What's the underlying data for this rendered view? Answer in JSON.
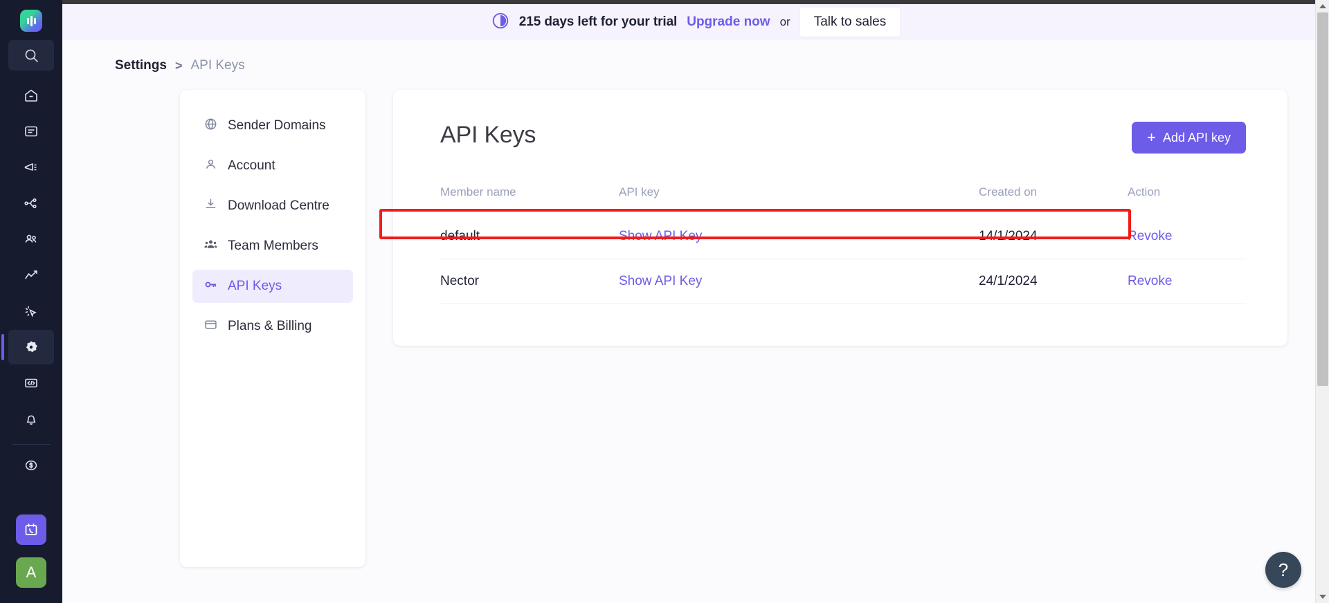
{
  "colors": {
    "brand_purple": "#6c5ce7",
    "rail_dark": "#161b2e",
    "banner_bg": "#f6f3ff",
    "highlight_red": "#f01c1c",
    "avatar_green": "#6aa84f",
    "help_navy": "#37475a"
  },
  "rail": {
    "logo_name": "app-logo",
    "search_icon": "search-icon",
    "items": [
      {
        "icon": "home-icon",
        "name": "rail-item-home",
        "active": false
      },
      {
        "icon": "inbox-icon",
        "name": "rail-item-inbox",
        "active": false
      },
      {
        "icon": "megaphone-icon",
        "name": "rail-item-campaigns",
        "active": false
      },
      {
        "icon": "workflow-icon",
        "name": "rail-item-workflows",
        "active": false
      },
      {
        "icon": "people-icon",
        "name": "rail-item-audience",
        "active": false
      },
      {
        "icon": "chart-line-icon",
        "name": "rail-item-analytics",
        "active": false
      },
      {
        "icon": "cursor-click-icon",
        "name": "rail-item-events",
        "active": false
      },
      {
        "icon": "gear-icon",
        "name": "rail-item-settings",
        "active": true
      },
      {
        "icon": "code-icon",
        "name": "rail-item-developers",
        "active": false
      },
      {
        "icon": "bell-icon",
        "name": "rail-item-notifications",
        "active": false
      }
    ],
    "billing_icon": "dollar-circle-icon",
    "cta_icon": "calendar-call-icon",
    "avatar_letter": "A"
  },
  "banner": {
    "clock_icon": "trial-clock-icon",
    "message": "215 days left for your trial",
    "upgrade_label": "Upgrade now",
    "or_label": "or",
    "sales_button": "Talk to sales"
  },
  "breadcrumb": {
    "root": "Settings",
    "separator": ">",
    "current": "API Keys"
  },
  "settings_menu": {
    "items": [
      {
        "label": "Sender Domains",
        "icon": "globe-icon",
        "active": false
      },
      {
        "label": "Account",
        "icon": "user-icon",
        "active": false
      },
      {
        "label": "Download Centre",
        "icon": "download-icon",
        "active": false
      },
      {
        "label": "Team Members",
        "icon": "team-icon",
        "active": false
      },
      {
        "label": "API Keys",
        "icon": "key-icon",
        "active": true
      },
      {
        "label": "Plans & Billing",
        "icon": "credit-card-icon",
        "active": false
      }
    ]
  },
  "panel": {
    "title": "API Keys",
    "add_button": "Add API key",
    "add_button_plus": "+",
    "table": {
      "headers": [
        "Member name",
        "API key",
        "Created on",
        "Action"
      ],
      "rows": [
        {
          "member_name": "default",
          "api_key_link": "Show API Key",
          "created_on": "14/1/2024",
          "action": "Revoke",
          "highlighted": true
        },
        {
          "member_name": "Nector",
          "api_key_link": "Show API Key",
          "created_on": "24/1/2024",
          "action": "Revoke",
          "highlighted": false
        }
      ]
    }
  },
  "help": {
    "label": "?"
  }
}
